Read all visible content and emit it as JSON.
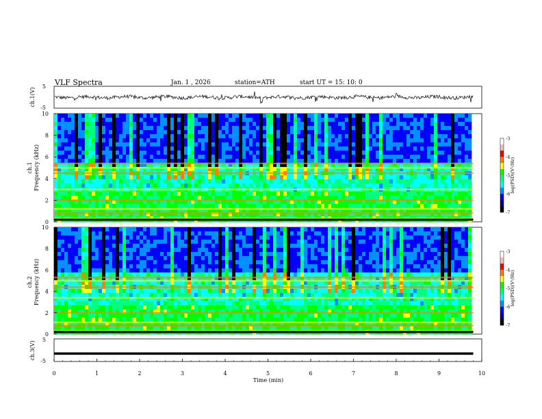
{
  "header": {
    "title": "VLF  Spectra",
    "date": "Jan.  1  , 2026",
    "station": "station=ATH",
    "start": "start  UT  =    15: 10: 0"
  },
  "chart_data": [
    {
      "type": "line",
      "name": "ch1-waveform",
      "ylabel": "ch.1(V)",
      "ylim": [
        -5,
        5
      ],
      "yticks": [
        "5",
        "-5"
      ],
      "xlim": [
        0,
        10
      ],
      "note_level": 0
    },
    {
      "type": "heatmap",
      "name": "ch1-spectrogram",
      "ylabel": "ch.1\nFrequency  (kHz)",
      "ylim": [
        0,
        10
      ],
      "yticks": [
        "0",
        "2",
        "4",
        "6",
        "8",
        "10"
      ],
      "xlim": [
        0,
        9.8
      ],
      "colorbar": {
        "label": "log(PSD)(V²/Hz)",
        "range": [
          -7,
          -3
        ],
        "ticks": [
          "-3",
          "-4",
          "-5",
          "-6",
          "-7"
        ]
      },
      "bands_khz": [
        0.3,
        0.8,
        1.2,
        2.0,
        3.0,
        4.5,
        5.0,
        5.4
      ]
    },
    {
      "type": "heatmap",
      "name": "ch2-spectrogram",
      "ylabel": "ch.2\nFrequency  (kHz)",
      "ylim": [
        0,
        10
      ],
      "yticks": [
        "0",
        "2",
        "4",
        "6",
        "8",
        "10"
      ],
      "xlim": [
        0,
        9.8
      ],
      "colorbar": {
        "label": "log(PSD)(V²/Hz)",
        "range": [
          -7,
          -3
        ],
        "ticks": [
          "-3",
          "-4",
          "-5",
          "-6",
          "-7"
        ]
      },
      "bands_khz": [
        0.3,
        0.8,
        1.1,
        2.0,
        3.4,
        4.4,
        5.0,
        5.3
      ]
    },
    {
      "type": "line",
      "name": "ch3-level",
      "ylabel": "ch.3(V)",
      "ylim": [
        -5,
        5
      ],
      "yticks": [
        "5",
        "-5"
      ],
      "xlim": [
        0,
        9.8
      ],
      "constant_value": -1.5
    }
  ],
  "xaxis": {
    "label": "Time  (min)",
    "ticks": [
      "0",
      "1",
      "2",
      "3",
      "4",
      "5",
      "6",
      "7",
      "8",
      "9",
      "10"
    ]
  },
  "colors": {
    "palette": [
      "#000000",
      "#00008b",
      "#0000ff",
      "#0090ff",
      "#00ffff",
      "#00ff80",
      "#00ff00",
      "#ffff00",
      "#ff8000",
      "#ff0000",
      "#ffffff"
    ]
  }
}
